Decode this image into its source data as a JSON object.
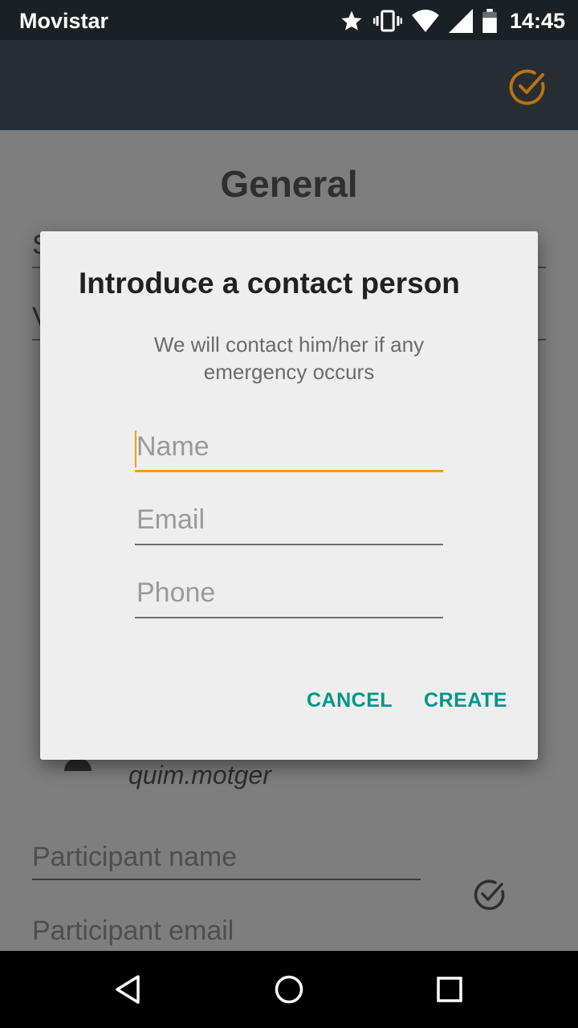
{
  "status_bar": {
    "carrier": "Movistar",
    "time": "14:45",
    "icons": [
      "star-icon",
      "vibrate-icon",
      "wifi-icon",
      "signal-icon",
      "battery-icon"
    ]
  },
  "app_bar": {
    "action_icon": "check-circle-icon",
    "accent_color": "#b87410"
  },
  "background": {
    "section_title": "General",
    "field_fragment_1": "S",
    "field_fragment_2": "V",
    "username": "quim.motger",
    "participant_name_placeholder": "Participant name",
    "participant_email_placeholder": "Participant email"
  },
  "dialog": {
    "title": "Introduce a contact person",
    "subtitle": "We will contact him/her if any emergency occurs",
    "fields": {
      "name": {
        "placeholder": "Name",
        "value": ""
      },
      "email": {
        "placeholder": "Email",
        "value": ""
      },
      "phone": {
        "placeholder": "Phone",
        "value": ""
      }
    },
    "cancel_label": "CANCEL",
    "create_label": "CREATE",
    "button_color": "#009688",
    "focus_color": "#f59d0e"
  },
  "nav_bar": {
    "icons": [
      "back-icon",
      "home-icon",
      "recents-icon"
    ]
  }
}
